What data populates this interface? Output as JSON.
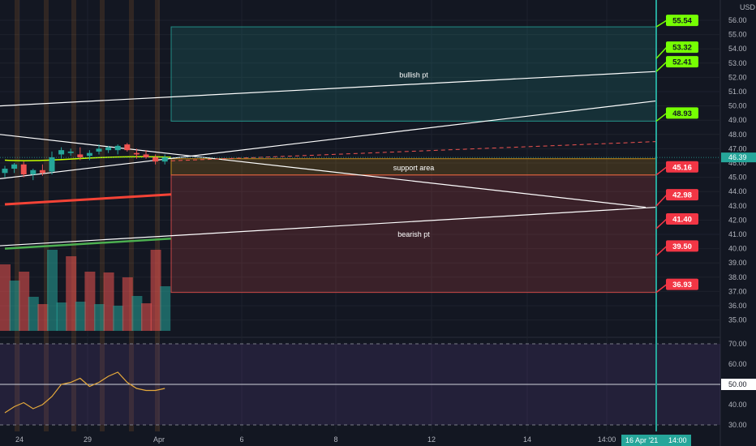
{
  "chart_data": [
    {
      "type": "candlestick",
      "currency": "USD",
      "ylim": [
        34,
        57
      ],
      "y_ticks": [
        35,
        36,
        37,
        38,
        39,
        40,
        41,
        42,
        43,
        44,
        45,
        46,
        47,
        48,
        49,
        50,
        51,
        52,
        53,
        54,
        55,
        56
      ],
      "y_tick_labels": [
        "35.00",
        "36.00",
        "37.00",
        "38.00",
        "39.00",
        "40.00",
        "41.00",
        "42.00",
        "43.00",
        "44.00",
        "45.00",
        "46.00",
        "47.00",
        "48.00",
        "49.00",
        "50.00",
        "51.00",
        "52.00",
        "53.00",
        "54.00",
        "55.00",
        "56.00"
      ],
      "current_price": "46.39",
      "candles": [
        {
          "o": 45.3,
          "h": 45.8,
          "l": 45.0,
          "c": 45.6
        },
        {
          "o": 45.6,
          "h": 46.0,
          "l": 45.3,
          "c": 45.9
        },
        {
          "o": 45.9,
          "h": 46.1,
          "l": 45.0,
          "c": 45.2
        },
        {
          "o": 45.2,
          "h": 45.6,
          "l": 44.8,
          "c": 45.5
        },
        {
          "o": 45.5,
          "h": 45.9,
          "l": 45.1,
          "c": 45.3
        },
        {
          "o": 45.4,
          "h": 46.8,
          "l": 45.2,
          "c": 46.4
        },
        {
          "o": 46.6,
          "h": 47.1,
          "l": 46.3,
          "c": 46.9
        },
        {
          "o": 46.7,
          "h": 47.0,
          "l": 46.5,
          "c": 46.8
        },
        {
          "o": 46.6,
          "h": 47.1,
          "l": 46.2,
          "c": 46.4
        },
        {
          "o": 46.5,
          "h": 46.9,
          "l": 46.2,
          "c": 46.7
        },
        {
          "o": 46.8,
          "h": 47.3,
          "l": 46.6,
          "c": 47.0
        },
        {
          "o": 46.9,
          "h": 47.2,
          "l": 46.7,
          "c": 47.1
        },
        {
          "o": 46.9,
          "h": 47.3,
          "l": 46.6,
          "c": 47.2
        },
        {
          "o": 47.3,
          "h": 47.4,
          "l": 46.8,
          "c": 46.9
        },
        {
          "o": 46.7,
          "h": 47.0,
          "l": 46.3,
          "c": 46.6
        },
        {
          "o": 46.6,
          "h": 46.9,
          "l": 46.3,
          "c": 46.4
        },
        {
          "o": 46.4,
          "h": 46.6,
          "l": 45.9,
          "c": 46.1
        },
        {
          "o": 46.1,
          "h": 46.6,
          "l": 45.9,
          "c": 46.4
        }
      ],
      "volume_up": [
        false,
        true,
        false,
        true,
        false,
        true,
        true,
        false,
        true,
        false,
        true,
        false,
        true,
        false,
        true,
        false,
        false,
        true
      ],
      "volume_rel": [
        0.82,
        0.62,
        0.73,
        0.42,
        0.33,
        1.0,
        0.35,
        0.92,
        0.36,
        0.73,
        0.33,
        0.72,
        0.31,
        0.66,
        0.43,
        0.34,
        1.0,
        0.55
      ],
      "x_tick_labels": [
        "24",
        "29",
        "Apr",
        "6",
        "8",
        "12",
        "14",
        "14:00"
      ],
      "cursor_label": "16 Apr '21",
      "cursor_time_label": "14:00",
      "zones": [
        {
          "label": "bullish pt",
          "from": 48.93,
          "to": 55.54,
          "color": "#26a69a"
        },
        {
          "label": "support area",
          "from": 45.16,
          "to": 46.3,
          "color": "#e8a317"
        },
        {
          "label": "bearish pt",
          "from": 36.93,
          "to": 45.16,
          "color": "#ef5350"
        }
      ],
      "target_labels": [
        {
          "value": 55.54,
          "text": "55.54",
          "kind": "up"
        },
        {
          "value": 53.32,
          "text": "53.32",
          "kind": "up"
        },
        {
          "value": 52.41,
          "text": "52.41",
          "kind": "up"
        },
        {
          "value": 48.93,
          "text": "48.93",
          "kind": "up"
        },
        {
          "value": 45.16,
          "text": "45.16",
          "kind": "down"
        },
        {
          "value": 42.98,
          "text": "42.98",
          "kind": "down"
        },
        {
          "value": 41.4,
          "text": "41.40",
          "kind": "down"
        },
        {
          "value": 39.5,
          "text": "39.50",
          "kind": "down"
        },
        {
          "value": 36.93,
          "text": "36.93",
          "kind": "down"
        }
      ],
      "colors": {
        "up": "#26a69a",
        "down": "#ef5350",
        "target_up": "#76ff03",
        "target_down": "#f23645",
        "cursor": "#26a69a"
      }
    },
    {
      "type": "line",
      "ylim": [
        28,
        72
      ],
      "y_ticks": [
        30,
        40,
        50,
        60,
        70
      ],
      "y_tick_labels": [
        "30.00",
        "40.00",
        "50.00",
        "60.00",
        "70.00"
      ],
      "bands": [
        30,
        70
      ],
      "midline": 50,
      "midline_label": "50.00",
      "values": [
        36,
        39,
        41,
        38,
        40,
        44,
        50,
        51,
        53,
        49,
        51,
        54,
        56,
        51,
        48,
        47,
        47,
        48
      ],
      "color": "#e5a93c"
    }
  ]
}
